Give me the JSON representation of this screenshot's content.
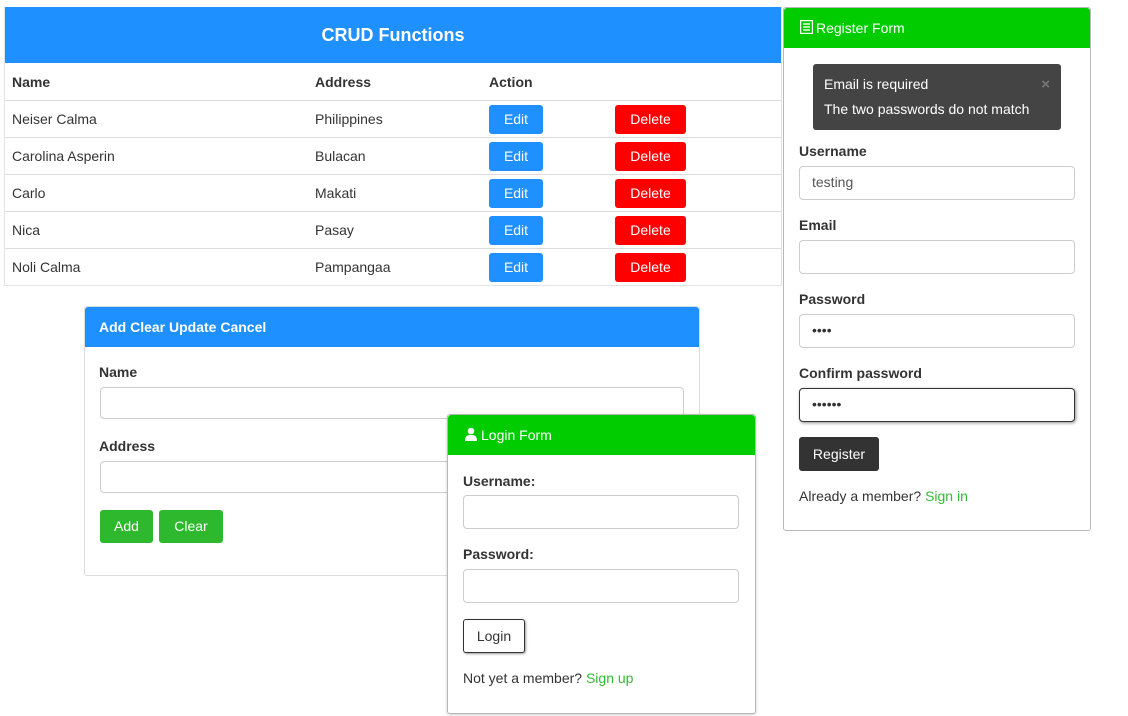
{
  "crud": {
    "title": "CRUD Functions",
    "columns": {
      "name": "Name",
      "address": "Address",
      "action": "Action"
    },
    "rows": [
      {
        "name": "Neiser Calma",
        "address": "Philippines",
        "edit": "Edit",
        "delete": "Delete"
      },
      {
        "name": "Carolina Asperin",
        "address": "Bulacan",
        "edit": "Edit",
        "delete": "Delete"
      },
      {
        "name": "Carlo",
        "address": "Makati",
        "edit": "Edit",
        "delete": "Delete"
      },
      {
        "name": "Nica",
        "address": "Pasay",
        "edit": "Edit",
        "delete": "Delete"
      },
      {
        "name": "Noli Calma",
        "address": "Pampangaa",
        "edit": "Edit",
        "delete": "Delete"
      }
    ]
  },
  "add_panel": {
    "title": "Add Clear Update Cancel",
    "name_label": "Name",
    "name_value": "",
    "address_label": "Address",
    "address_value": "",
    "add_button": "Add",
    "clear_button": "Clear"
  },
  "login": {
    "title": "Login Form",
    "username_label": "Username:",
    "username_value": "",
    "password_label": "Password:",
    "password_value": "",
    "login_button": "Login",
    "footer_text": "Not yet a member?",
    "signup_link": "Sign up"
  },
  "register": {
    "title": "Register Form",
    "errors": [
      "Email is required",
      "The two passwords do not match"
    ],
    "close_symbol": "×",
    "username_label": "Username",
    "username_value": "testing",
    "email_label": "Email",
    "email_value": "",
    "password_label": "Password",
    "password_value": "••••",
    "confirm_label": "Confirm password",
    "confirm_value": "••••••",
    "register_button": "Register",
    "footer_text": "Already a member?",
    "signin_link": "Sign in"
  },
  "colors": {
    "primary_blue": "#1e90ff",
    "delete_red": "#ff0000",
    "header_green": "#00cc00",
    "button_green": "#2eb82e",
    "link_green": "#33bb33",
    "alert_dark": "#444444"
  },
  "icons": {
    "register": "list-icon",
    "login": "user-icon"
  }
}
